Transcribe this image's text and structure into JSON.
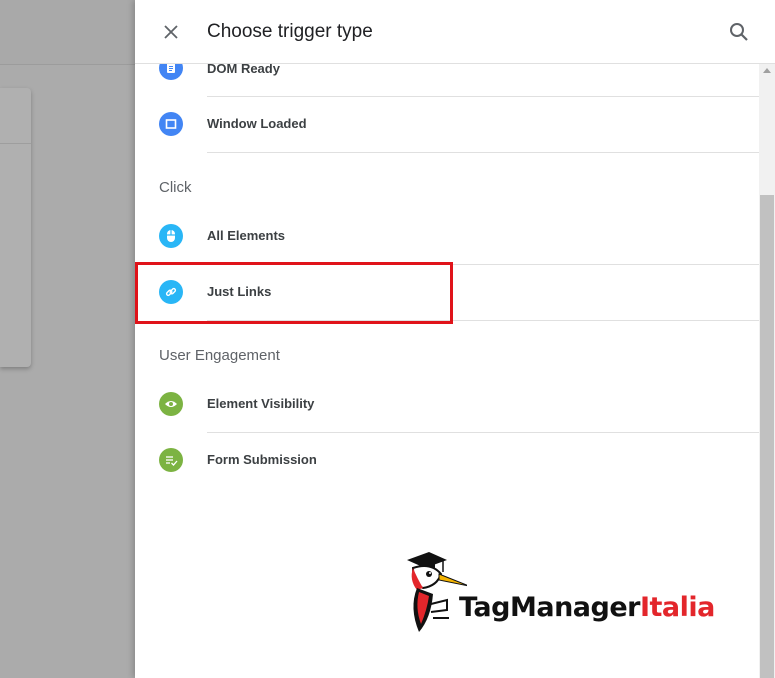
{
  "header": {
    "title": "Choose trigger type"
  },
  "items": [
    {
      "label": "DOM Ready",
      "icon": "document-icon",
      "color": "#4285f4"
    },
    {
      "label": "Window Loaded",
      "icon": "window-icon",
      "color": "#4285f4"
    },
    {
      "label": "All Elements",
      "icon": "mouse-icon",
      "color": "#29b6f6"
    },
    {
      "label": "Just Links",
      "icon": "link-icon",
      "color": "#29b6f6"
    },
    {
      "label": "Element Visibility",
      "icon": "eye-icon",
      "color": "#7cb342"
    },
    {
      "label": "Form Submission",
      "icon": "form-icon",
      "color": "#7cb342"
    }
  ],
  "sections": {
    "click": "Click",
    "engagement": "User Engagement"
  },
  "logo": {
    "brand": "TagManager",
    "brand_suffix": "Italia",
    "brand_color": "#111111",
    "suffix_color": "#e3262b"
  },
  "colors": {
    "highlight": "#e0131a",
    "page_load_icon": "#4285f4",
    "click_icon": "#29b6f6",
    "engagement_icon": "#7cb342"
  }
}
